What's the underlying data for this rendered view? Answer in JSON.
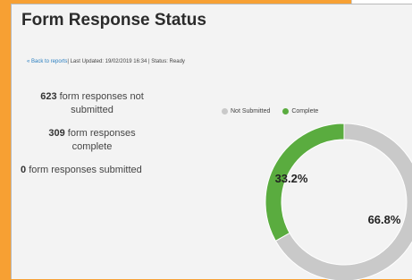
{
  "page": {
    "title": "Form Response Status"
  },
  "meta": {
    "back_link": "« Back to reports",
    "info": "| Last Updated: 19/02/2019 16:34 | Status: Ready"
  },
  "stats": [
    {
      "count": "623",
      "text": "form responses not submitted"
    },
    {
      "count": "309",
      "text": "form responses complete"
    },
    {
      "count": "0",
      "text": "form responses submitted"
    }
  ],
  "legend": [
    {
      "label": "Not Submitted",
      "color": "#c9c9c9"
    },
    {
      "label": "Complete",
      "color": "#5aac3f"
    }
  ],
  "chart_data": {
    "type": "pie",
    "categories": [
      "Not Submitted",
      "Complete"
    ],
    "values": [
      66.8,
      33.2
    ],
    "data_labels": [
      "66.8%",
      "33.2%"
    ],
    "colors": [
      "#c9c9c9",
      "#5aac3f"
    ],
    "style": "donut"
  }
}
